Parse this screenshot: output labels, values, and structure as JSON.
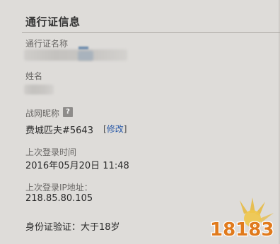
{
  "section": {
    "title": "通行证信息"
  },
  "account_name": {
    "label": "通行证名称"
  },
  "real_name": {
    "label": "姓名"
  },
  "battle_tag": {
    "label": "战网昵称",
    "help_icon": "question-mark-icon",
    "help_glyph": "?",
    "value": "费城匹夫#5643",
    "modify_open": "[",
    "modify_label": "修改",
    "modify_close": "]"
  },
  "last_login_time": {
    "label": "上次登录时间",
    "value": "2016年05月20日 11:48"
  },
  "last_login_ip": {
    "label": "上次登录IP地址：",
    "value": "218.85.80.105"
  },
  "id_verification": {
    "text": "身份证验证：大于18岁"
  },
  "watermark": {
    "text": "18183"
  },
  "colors": {
    "background": "#dedcd9",
    "link": "#2a5aa8",
    "watermark_gold": "#e8b93a",
    "watermark_orange": "#e07a1c"
  }
}
